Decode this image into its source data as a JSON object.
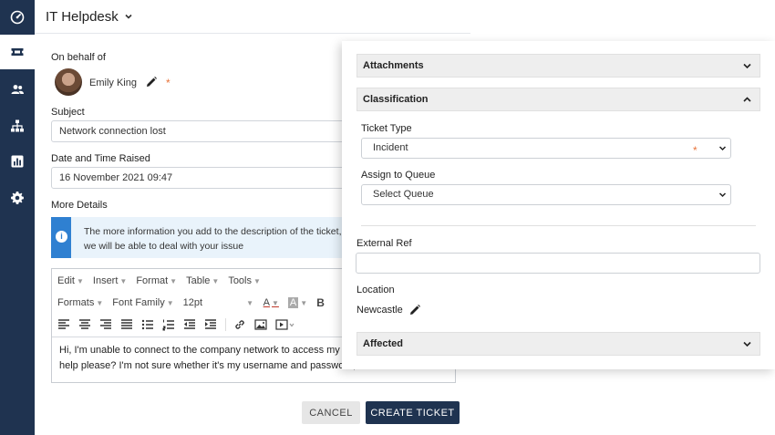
{
  "app": {
    "title": "IT Helpdesk"
  },
  "sidebar": {
    "items": [
      {
        "name": "dashboard",
        "icon": "speedometer-icon"
      },
      {
        "name": "tickets",
        "icon": "ticket-icon",
        "active": true
      },
      {
        "name": "users",
        "icon": "users-icon"
      },
      {
        "name": "org",
        "icon": "org-chart-icon"
      },
      {
        "name": "reports",
        "icon": "bar-chart-icon"
      },
      {
        "name": "settings",
        "icon": "gear-icon"
      }
    ],
    "colors": {
      "background": "#1f3350"
    }
  },
  "form": {
    "on_behalf_label": "On behalf of",
    "person_name": "Emily King",
    "required_mark": "*",
    "subject_label": "Subject",
    "subject_value": "Network connection lost",
    "date_label": "Date and Time Raised",
    "date_value": "16 November 2021 09:47",
    "more_details_label": "More Details",
    "info_line1": "The more information you add to the description of the ticket, the",
    "info_line2": "we will be able to deal with your issue"
  },
  "editor": {
    "menus": [
      "Edit",
      "Insert",
      "Format",
      "Table",
      "Tools"
    ],
    "formats_label": "Formats",
    "font_family_label": "Font Family",
    "font_size": "12pt",
    "bold_label": "B",
    "font_color_label": "A",
    "bg_color_label": "A",
    "body_line1": "Hi, I'm unable to connect to the company network to access my wo",
    "body_line2": "help please? I'm not sure whether it's my username and password,"
  },
  "actions": {
    "cancel_label": "CANCEL",
    "create_label": "CREATE TICKET"
  },
  "panel": {
    "attachments_label": "Attachments",
    "classification_label": "Classification",
    "ticket_type_label": "Ticket Type",
    "ticket_type_value": "Incident",
    "required_mark": "*",
    "assign_queue_label": "Assign to Queue",
    "assign_queue_value": "Select Queue",
    "external_ref_label": "External Ref",
    "location_label": "Location",
    "location_value": "Newcastle",
    "affected_label": "Affected"
  },
  "colors": {
    "accent": "#1f3350",
    "info_bar": "#2f80d1",
    "required": "#e8743b"
  }
}
